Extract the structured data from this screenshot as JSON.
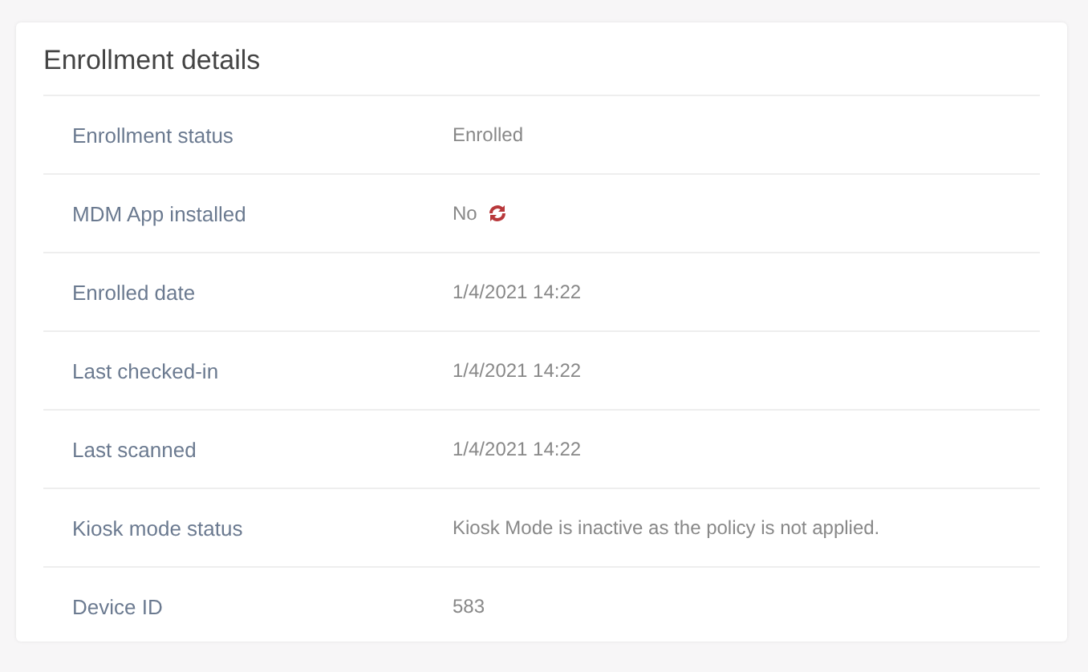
{
  "card": {
    "title": "Enrollment details",
    "rows": [
      {
        "kind": "text",
        "label": "Enrollment status",
        "value": "Enrolled"
      },
      {
        "kind": "retry",
        "label": "MDM App installed",
        "value": "No"
      },
      {
        "kind": "text",
        "label": "Enrolled date",
        "value": "1/4/2021 14:22"
      },
      {
        "kind": "text",
        "label": "Last checked-in",
        "value": "1/4/2021 14:22"
      },
      {
        "kind": "text",
        "label": "Last scanned",
        "value": "1/4/2021 14:22"
      },
      {
        "kind": "text",
        "label": "Kiosk mode status",
        "value": "Kiosk Mode is inactive as the policy is not applied."
      },
      {
        "kind": "text",
        "label": "Device ID",
        "value": "583"
      }
    ]
  }
}
